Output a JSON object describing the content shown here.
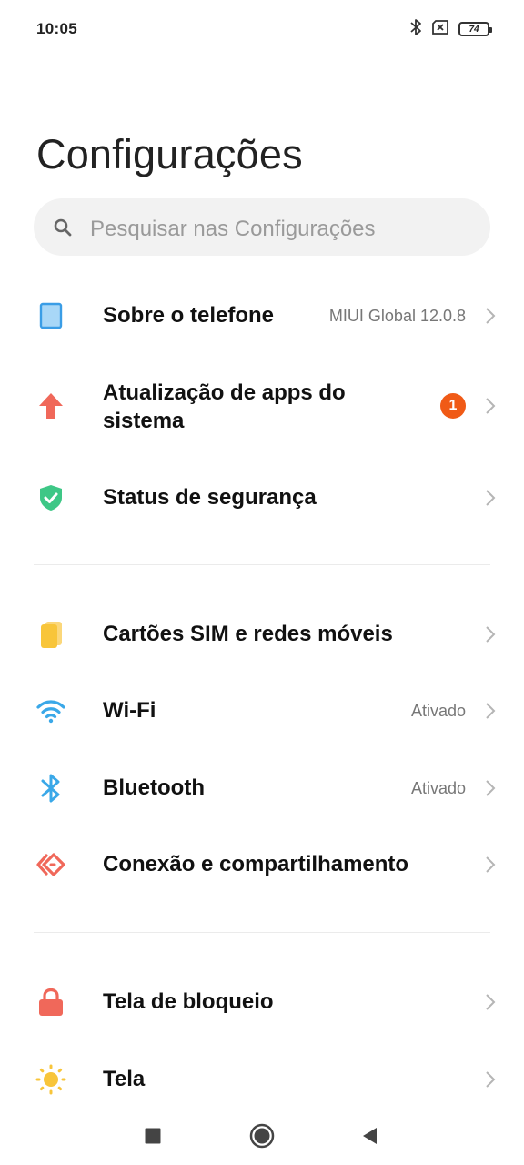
{
  "status_bar": {
    "time": "10:05",
    "battery_level": "74",
    "icons": [
      "bluetooth-icon",
      "sim-missing-icon",
      "battery-icon"
    ]
  },
  "page_title": "Configurações",
  "search": {
    "placeholder": "Pesquisar nas Configurações"
  },
  "sections": [
    {
      "items": [
        {
          "label": "Sobre o telefone",
          "value": "MIUI Global 12.0.8",
          "icon": "phone-icon",
          "color": "#4aa3e8"
        },
        {
          "label_line1": "Atualização de apps do",
          "label_line2": "sistema",
          "badge": "1",
          "icon": "arrow-up-icon",
          "color": "#f0685a"
        },
        {
          "label": "Status de segurança",
          "icon": "shield-check-icon",
          "color": "#3ec786"
        }
      ]
    },
    {
      "items": [
        {
          "label": "Cartões SIM e redes móveis",
          "icon": "sim-card-icon",
          "color": "#f8c53a"
        },
        {
          "label": "Wi-Fi",
          "value": "Ativado",
          "icon": "wifi-icon",
          "color": "#3aa8e8"
        },
        {
          "label": "Bluetooth",
          "value": "Ativado",
          "icon": "bluetooth-icon",
          "color": "#3aa8e8"
        },
        {
          "label": "Conexão e compartilhamento",
          "icon": "connection-share-icon",
          "color": "#f0685a"
        }
      ]
    },
    {
      "items": [
        {
          "label": "Tela de bloqueio",
          "icon": "lock-icon",
          "color": "#f0685a"
        },
        {
          "label": "Tela",
          "icon": "sun-icon",
          "color": "#f8c53a"
        }
      ]
    }
  ],
  "nav_bar": {
    "buttons": [
      "recents-button",
      "home-button",
      "back-button"
    ]
  }
}
